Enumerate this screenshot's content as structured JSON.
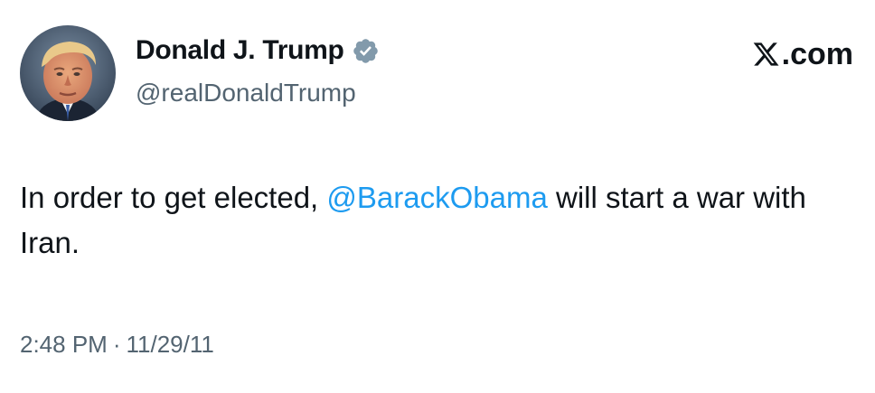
{
  "author": {
    "display_name": "Donald J. Trump",
    "handle": "@realDonaldTrump",
    "verified": true,
    "avatar_icon": "profile-photo"
  },
  "brand": {
    "text": ".com",
    "logo_icon": "x-logo"
  },
  "tweet": {
    "text_before": "In order to get elected, ",
    "mention": "@BarackObama",
    "text_after": " will start a war with Iran."
  },
  "meta": {
    "time": "2:48 PM",
    "separator": "·",
    "date": "11/29/11"
  },
  "colors": {
    "text": "#0f1419",
    "secondary": "#536471",
    "mention": "#1d9bf0",
    "verified_badge": "#829aab"
  }
}
